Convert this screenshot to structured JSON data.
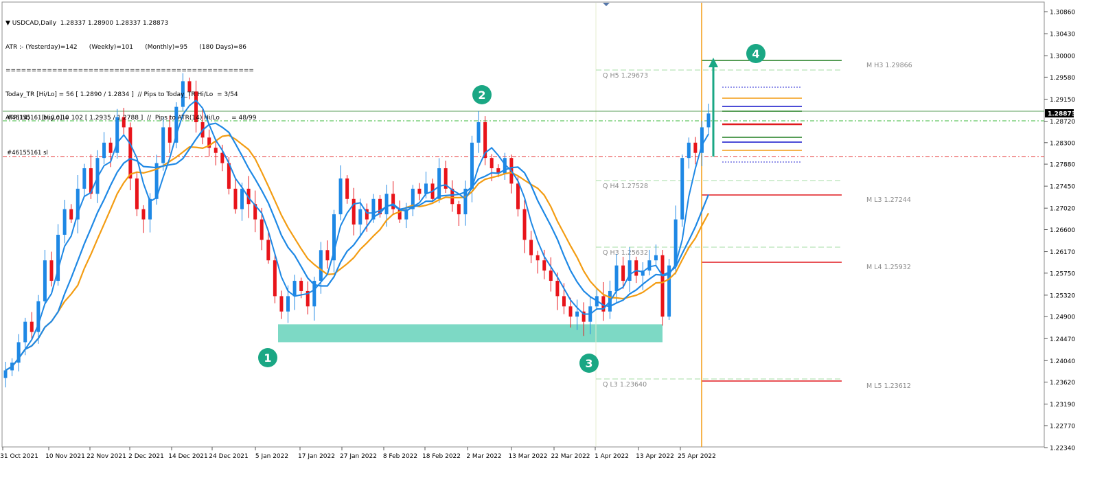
{
  "header": {
    "symbol": "USDCAD,Daily",
    "ohlc": "1.28337 1.28900 1.28337 1.28873",
    "atr_line": "ATR :- (Yesterday)=142      (Weekly)=101      (Monthly)=95      (180 Days)=86",
    "separator": "================================================",
    "today_tr": "Today_TR [Hi/Lo] = 56 [ 1.2890 / 1.2834 ]  // Pips to Today_TR Hi/Lo  = 3/54",
    "atr14": "ATR(14)      [Hi/Lo] = 102 [ 1.2935 / 1.2788 ]  //  Pips to ATR(14) Hi/Lo      = 48/99"
  },
  "orders": {
    "buy_label": "#46155161 buy 0.10",
    "sl_label": "#46155161 sl",
    "current_price": "1.28873"
  },
  "pivots": {
    "q_h5": "Q  H5 1.29673",
    "q_h4": "Q  H4 1.27528",
    "q_h3": "Q  H3 1.25632",
    "q_l3": "Q  L3 1.23640",
    "m_h3": "M  H3 1.29866",
    "m_l3": "M  L3 1.27244",
    "m_l4": "M  L4 1.25932",
    "m_l5": "M  L5 1.23612"
  },
  "markers": [
    "1",
    "2",
    "3",
    "4"
  ],
  "colors": {
    "bull": "#1e88e5",
    "bear": "#e8141a",
    "ma_fast": "#1e88e5",
    "ma_slow": "#f39c12",
    "zone": "#7dd9c5",
    "marker": "#1aa784",
    "vline": "#f39c12",
    "pivot_red": "#e0191e",
    "pivot_green": "#1e7d1e"
  },
  "chart_data": {
    "type": "candlestick",
    "symbol": "USDCAD",
    "timeframe": "Daily",
    "ylim": [
      1.2234,
      1.3086
    ],
    "y_ticks": [
      "1.30860",
      "1.30430",
      "1.30000",
      "1.29580",
      "1.29150",
      "1.28720",
      "1.28300",
      "1.27880",
      "1.27450",
      "1.27020",
      "1.26600",
      "1.26170",
      "1.25750",
      "1.25320",
      "1.24900",
      "1.24470",
      "1.24040",
      "1.23620",
      "1.23190",
      "1.22770",
      "1.22340"
    ],
    "x_ticks": [
      "31 Oct 2021",
      "10 Nov 2021",
      "22 Nov 2021",
      "2 Dec 2021",
      "14 Dec 2021",
      "24 Dec 2021",
      "5 Jan 2022",
      "17 Jan 2022",
      "27 Jan 2022",
      "8 Feb 2022",
      "18 Feb 2022",
      "2 Mar 2022",
      "13 Mar 2022",
      "22 Mar 2022",
      "1 Apr 2022",
      "13 Apr 2022",
      "25 Apr 2022"
    ],
    "support_zone": [
      1.244,
      1.2475
    ],
    "buy_price": 1.2885,
    "sl_price": 1.28,
    "closes": [
      1.2385,
      1.24,
      1.244,
      1.248,
      1.246,
      1.252,
      1.26,
      1.256,
      1.265,
      1.27,
      1.268,
      1.274,
      1.278,
      1.273,
      1.28,
      1.283,
      1.281,
      1.288,
      1.286,
      1.276,
      1.27,
      1.268,
      1.272,
      1.279,
      1.286,
      1.283,
      1.29,
      1.295,
      1.293,
      1.287,
      1.284,
      1.282,
      1.281,
      1.279,
      1.274,
      1.27,
      1.274,
      1.271,
      1.268,
      1.264,
      1.26,
      1.253,
      1.25,
      1.253,
      1.256,
      1.254,
      1.251,
      1.256,
      1.262,
      1.26,
      1.269,
      1.276,
      1.272,
      1.267,
      1.27,
      1.268,
      1.272,
      1.269,
      1.273,
      1.27,
      1.268,
      1.27,
      1.274,
      1.273,
      1.275,
      1.272,
      1.278,
      1.274,
      1.271,
      1.269,
      1.274,
      1.283,
      1.287,
      1.28,
      1.278,
      1.277,
      1.28,
      1.275,
      1.27,
      1.264,
      1.261,
      1.26,
      1.258,
      1.256,
      1.253,
      1.251,
      1.249,
      1.25,
      1.248,
      1.251,
      1.253,
      1.25,
      1.254,
      1.259,
      1.256,
      1.26,
      1.257,
      1.258,
      1.26,
      1.261,
      1.249,
      1.259,
      1.268,
      1.28,
      1.283,
      1.281,
      1.286,
      1.2887
    ],
    "moving_averages": [
      "fast",
      "slow",
      "slower"
    ]
  }
}
